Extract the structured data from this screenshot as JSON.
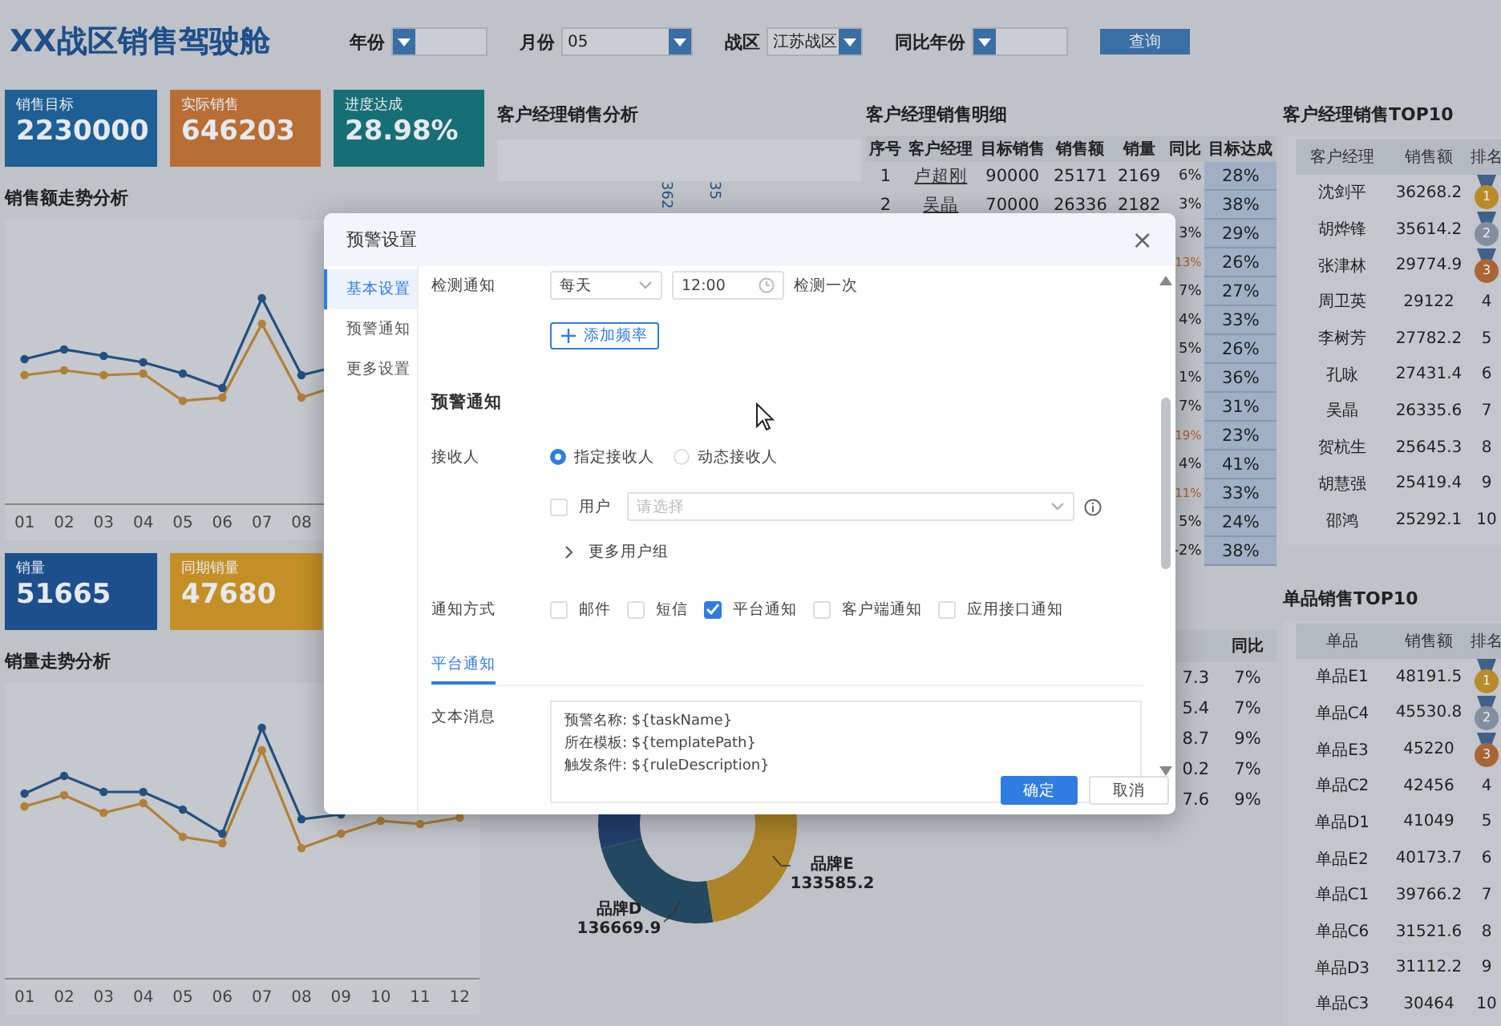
{
  "header": {
    "title": "XX战区销售驾驶舱",
    "filters": [
      {
        "label": "年份"
      },
      {
        "label": "月份",
        "value": "05"
      },
      {
        "label": "战区",
        "value": "江苏战区"
      },
      {
        "label": "同比年份"
      }
    ],
    "query_button": "查询"
  },
  "kpis": [
    {
      "label": "销售目标",
      "value": "2230000",
      "color": "#1e5f96"
    },
    {
      "label": "实际销售",
      "value": "646203",
      "color": "#b86e35"
    },
    {
      "label": "进度达成",
      "value": "28.98%",
      "color": "#166f75"
    }
  ],
  "sales_trend": {
    "title": "销售额走势分析",
    "x_labels": [
      "01",
      "02",
      "03",
      "04",
      "05",
      "06",
      "07",
      "08"
    ]
  },
  "kpis_2": [
    {
      "label": "销量",
      "value": "51665",
      "color": "#1d4f8d"
    },
    {
      "label": "同期销量",
      "value": "47680",
      "color": "#c48f25"
    }
  ],
  "volume_trend": {
    "title": "销量走势分析",
    "x_labels": [
      "01",
      "02",
      "03",
      "04",
      "05",
      "06",
      "07",
      "08",
      "09",
      "10",
      "11",
      "12"
    ]
  },
  "manager_analysis": {
    "title": "客户经理销售分析",
    "axis_labels": [
      "362",
      "35"
    ]
  },
  "brand_donut": {
    "labels": [
      {
        "name": "品牌D",
        "value": "136669.9"
      },
      {
        "name": "品牌E",
        "value": "133585.2"
      }
    ]
  },
  "detail": {
    "title": "客户经理销售明细",
    "columns": [
      "序号",
      "客户经理",
      "目标销售",
      "销售额",
      "销量",
      "同比",
      "目标达成"
    ],
    "rows": [
      {
        "no": "1",
        "manager": "卢超刚",
        "target": "90000",
        "sales": "25171",
        "volume": "2169",
        "yoy": "6%",
        "achieve": "28%",
        "declined": false
      },
      {
        "no": "2",
        "manager": "吴晶",
        "target": "70000",
        "sales": "26336",
        "volume": "2182",
        "yoy": "3%",
        "achieve": "38%",
        "declined": false
      },
      {
        "yoy": "3%",
        "achieve": "29%",
        "declined": false
      },
      {
        "yoy": "13%",
        "achieve": "26%",
        "declined": true
      },
      {
        "yoy": "7%",
        "achieve": "27%",
        "declined": false
      },
      {
        "yoy": "4%",
        "achieve": "33%",
        "declined": false
      },
      {
        "yoy": "5%",
        "achieve": "26%",
        "declined": false
      },
      {
        "yoy": "1%",
        "achieve": "36%",
        "declined": false
      },
      {
        "yoy": "7%",
        "achieve": "31%",
        "declined": false
      },
      {
        "yoy": "19%",
        "achieve": "23%",
        "declined": true
      },
      {
        "yoy": "4%",
        "achieve": "41%",
        "declined": false
      },
      {
        "yoy": "11%",
        "achieve": "33%",
        "declined": true
      },
      {
        "yoy": "5%",
        "achieve": "24%",
        "declined": false
      },
      {
        "yoy": "-2%",
        "achieve": "38%",
        "declined": false
      }
    ]
  },
  "product_detail": {
    "columns": [
      "同比"
    ],
    "rows": [
      {
        "sales": "7.3",
        "yoy": "7%"
      },
      {
        "sales": "5.4",
        "yoy": "7%"
      },
      {
        "sales": "8.7",
        "yoy": "9%"
      },
      {
        "sales": "0.2",
        "yoy": "7%"
      },
      {
        "sales": "7.6",
        "yoy": "9%"
      }
    ]
  },
  "manager_top10": {
    "title": "客户经理销售TOP10",
    "columns": [
      "客户经理",
      "销售额",
      "排名"
    ],
    "rows": [
      {
        "name": "沈剑平",
        "sales": "36268.2",
        "rank": "1",
        "color": "#b88c2a"
      },
      {
        "name": "胡烨锋",
        "sales": "35614.2",
        "rank": "2",
        "color": "#838fa0"
      },
      {
        "name": "张津林",
        "sales": "29774.9",
        "rank": "3",
        "color": "#a96535"
      },
      {
        "name": "周卫英",
        "sales": "29122",
        "rank": "4"
      },
      {
        "name": "李树芳",
        "sales": "27782.2",
        "rank": "5"
      },
      {
        "name": "孔咏",
        "sales": "27431.4",
        "rank": "6"
      },
      {
        "name": "吴晶",
        "sales": "26335.6",
        "rank": "7"
      },
      {
        "name": "贺杭生",
        "sales": "25645.3",
        "rank": "8"
      },
      {
        "name": "胡慧强",
        "sales": "25419.4",
        "rank": "9"
      },
      {
        "name": "邵鸿",
        "sales": "25292.1",
        "rank": "10"
      }
    ]
  },
  "product_top10": {
    "title": "单品销售TOP10",
    "columns": [
      "单品",
      "销售额",
      "排名"
    ],
    "rows": [
      {
        "name": "单品E1",
        "sales": "48191.5",
        "rank": "1",
        "color": "#b88c2a"
      },
      {
        "name": "单品C4",
        "sales": "45530.8",
        "rank": "2",
        "color": "#838fa0"
      },
      {
        "name": "单品E3",
        "sales": "45220",
        "rank": "3",
        "color": "#a96535"
      },
      {
        "name": "单品C2",
        "sales": "42456",
        "rank": "4"
      },
      {
        "name": "单品D1",
        "sales": "41049",
        "rank": "5"
      },
      {
        "name": "单品E2",
        "sales": "40173.7",
        "rank": "6"
      },
      {
        "name": "单品C1",
        "sales": "39766.2",
        "rank": "7"
      },
      {
        "name": "单品C6",
        "sales": "31521.6",
        "rank": "8"
      },
      {
        "name": "单品D3",
        "sales": "31112.2",
        "rank": "9"
      },
      {
        "name": "单品C3",
        "sales": "30464",
        "rank": "10"
      }
    ]
  },
  "modal": {
    "title": "预警设置",
    "close": "×",
    "nav": [
      {
        "label": "基本设置",
        "selected": true
      },
      {
        "label": "预警通知",
        "selected": false
      },
      {
        "label": "更多设置",
        "selected": false
      }
    ],
    "check_label": "检测通知",
    "frequency": "每天",
    "time": "12:00",
    "check_suffix": "检测一次",
    "add_button": "添加频率",
    "section_title": "预警通知",
    "recipient_label": "接收人",
    "recipient_options": [
      {
        "label": "指定接收人",
        "selected": true
      },
      {
        "label": "动态接收人",
        "selected": false
      }
    ],
    "user": {
      "label": "用户",
      "checked": false,
      "placeholder": "请选择"
    },
    "more_groups": {
      "label": "更多用户组",
      "expanded": false
    },
    "method_label": "通知方式",
    "methods": [
      {
        "label": "邮件",
        "checked": false
      },
      {
        "label": "短信",
        "checked": false
      },
      {
        "label": "平台通知",
        "checked": true
      },
      {
        "label": "客户端通知",
        "checked": false
      },
      {
        "label": "应用接口通知",
        "checked": false
      }
    ],
    "tabs": [
      {
        "label": "平台通知",
        "selected": true
      }
    ],
    "message_label": "文本消息",
    "message_lines": [
      "预警名称: ${taskName}",
      "所在模板: ${templatePath}",
      "触发条件: ${ruleDescription}"
    ],
    "buttons": [
      {
        "label": "确定",
        "kind": "primary"
      },
      {
        "label": "取消",
        "kind": "default"
      }
    ]
  }
}
